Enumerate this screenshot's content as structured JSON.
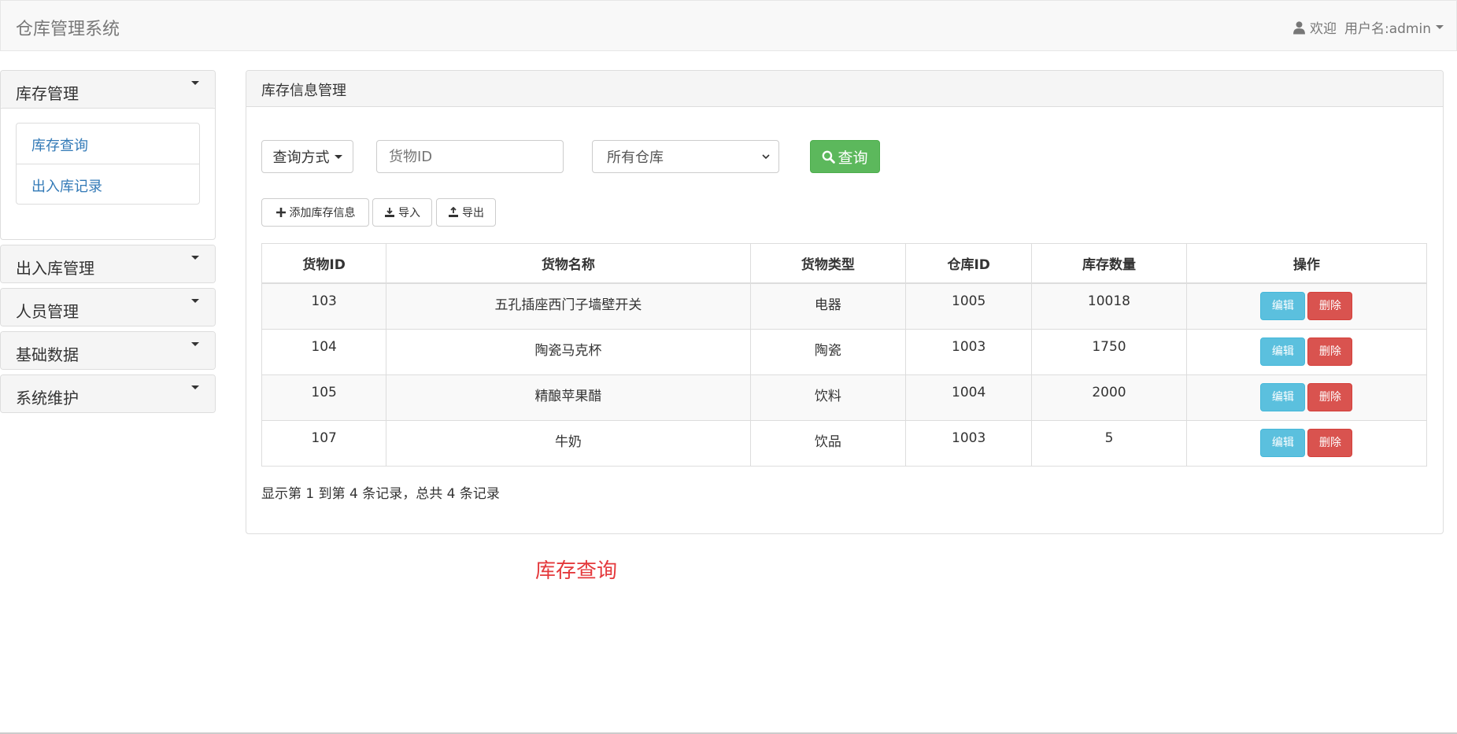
{
  "navbar": {
    "brand": "仓库管理系统",
    "welcome": "欢迎",
    "username": "用户名:admin",
    "user_icon": "user-icon"
  },
  "sidebar": {
    "panels": [
      {
        "label": "库存管理",
        "expanded": true,
        "items": [
          "库存查询",
          "出入库记录"
        ]
      },
      {
        "label": "出入库管理",
        "expanded": false
      },
      {
        "label": "人员管理",
        "expanded": false
      },
      {
        "label": "基础数据",
        "expanded": false
      },
      {
        "label": "系统维护",
        "expanded": false
      }
    ]
  },
  "main": {
    "title": "库存信息管理",
    "search": {
      "query_type_label": "查询方式",
      "goods_id_placeholder": "货物ID",
      "goods_id_value": "",
      "warehouse_selected": "所有仓库",
      "search_label": "查询"
    },
    "toolbar": {
      "add_label": "添加库存信息",
      "import_label": "导入",
      "export_label": "导出"
    },
    "table": {
      "columns": [
        "货物ID",
        "货物名称",
        "货物类型",
        "仓库ID",
        "库存数量",
        "操作"
      ],
      "rows": [
        [
          "103",
          "五孔插座西门子墙壁开关",
          "电器",
          "1005",
          "10018"
        ],
        [
          "104",
          "陶瓷马克杯",
          "陶瓷",
          "1003",
          "1750"
        ],
        [
          "105",
          "精酿苹果醋",
          "饮料",
          "1004",
          "2000"
        ],
        [
          "107",
          "牛奶",
          "饮品",
          "1003",
          "5"
        ]
      ],
      "edit_label": "编辑",
      "delete_label": "删除"
    },
    "summary": "显示第 1 到第 4 条记录，总共 4 条记录"
  },
  "page_label": "库存查询",
  "colors": {
    "success": "#5cb85c",
    "info": "#5bc0de",
    "danger": "#d9534f",
    "link": "#337ab7",
    "accent_red": "#e4393c"
  }
}
